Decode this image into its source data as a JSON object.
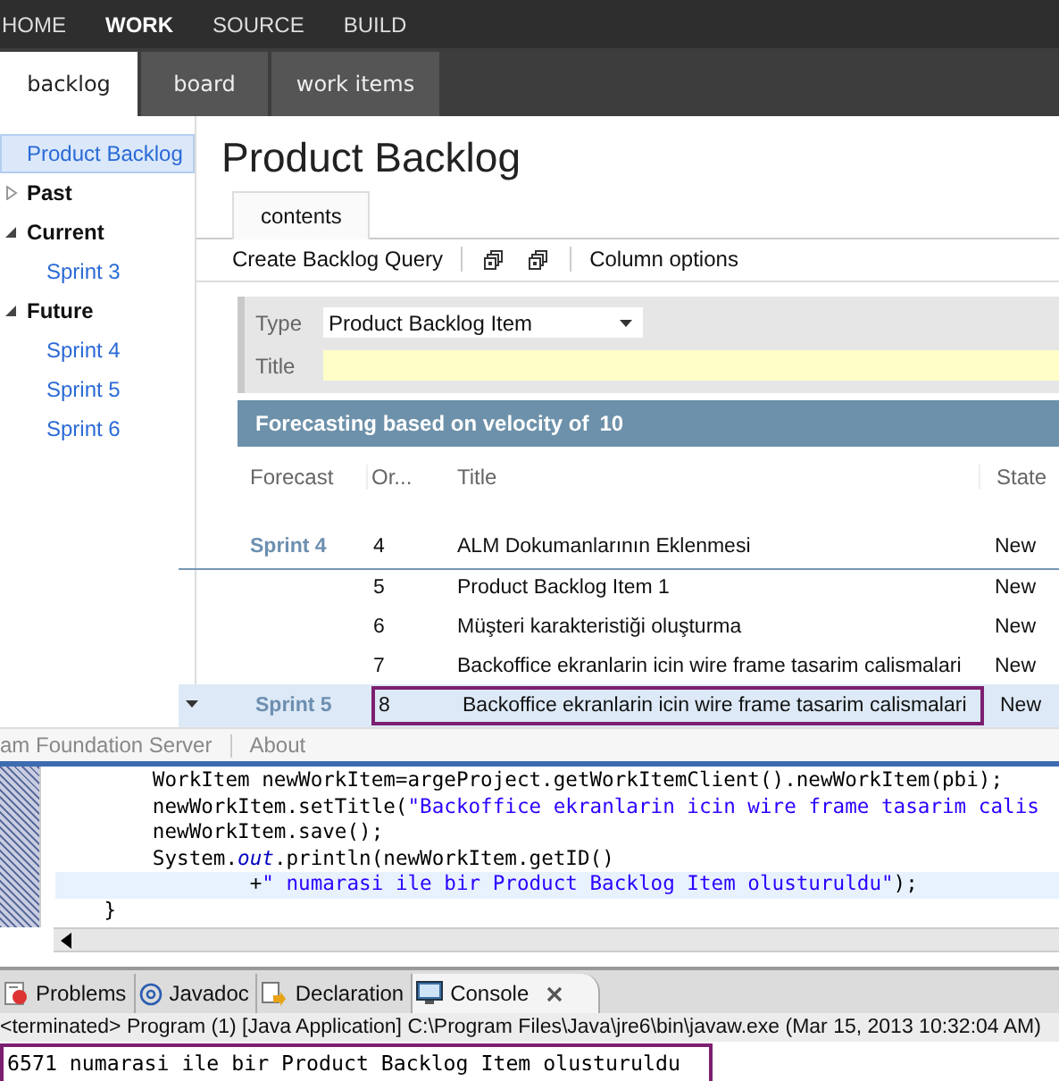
{
  "top_nav": [
    {
      "label": "HOME",
      "selected": false
    },
    {
      "label": "WORK",
      "selected": true
    },
    {
      "label": "SOURCE",
      "selected": false
    },
    {
      "label": "BUILD",
      "selected": false
    }
  ],
  "sub_tabs": [
    {
      "label": "backlog",
      "selected": true
    },
    {
      "label": "board",
      "selected": false
    },
    {
      "label": "work items",
      "selected": false
    }
  ],
  "sidebar": {
    "items": [
      {
        "label": "Product Backlog",
        "kind": "link",
        "selected": true
      },
      {
        "label": "Past",
        "kind": "group",
        "expanded": false
      },
      {
        "label": "Current",
        "kind": "group",
        "expanded": true,
        "children": [
          {
            "label": "Sprint 3",
            "kind": "link",
            "selected": false
          }
        ]
      },
      {
        "label": "Future",
        "kind": "group",
        "expanded": true,
        "children": [
          {
            "label": "Sprint 4",
            "kind": "link",
            "selected": false
          },
          {
            "label": "Sprint 5",
            "kind": "link",
            "selected": false
          },
          {
            "label": "Sprint 6",
            "kind": "link",
            "selected": false
          }
        ]
      }
    ]
  },
  "page_title": "Product Backlog",
  "content_tabs": [
    {
      "label": "contents",
      "selected": true
    }
  ],
  "toolbar": [
    {
      "kind": "text",
      "label": "Create Backlog Query"
    },
    {
      "kind": "separator"
    },
    {
      "kind": "expand"
    },
    {
      "kind": "collapse"
    },
    {
      "kind": "separator"
    },
    {
      "kind": "text",
      "label": "Column options"
    }
  ],
  "quick_add": {
    "type_label": "Type",
    "type_value": "Product Backlog Item",
    "title_label": "Title"
  },
  "forecast_banner": {
    "text": "Forecasting based on velocity of",
    "velocity": "10"
  },
  "table": {
    "columns": [
      "Forecast",
      "Or...",
      "Title",
      "State"
    ],
    "rows": [
      {
        "forecast": "Sprint 4",
        "order": "4",
        "title": "ALM Dokumanlarının Eklenmesi",
        "state": "New",
        "sprint_end": true,
        "selected": false,
        "boxed": false
      },
      {
        "order": "5",
        "title": "Product Backlog Item 1",
        "state": "New",
        "sprint_end": false,
        "selected": false,
        "boxed": false
      },
      {
        "order": "6",
        "title": "Müşteri karakteristiği oluşturma",
        "state": "New",
        "sprint_end": false,
        "selected": false,
        "boxed": false
      },
      {
        "order": "7",
        "title": "Backoffice ekranlarin icin wire frame tasarim calismalari",
        "state": "New",
        "sprint_end": false,
        "selected": false,
        "boxed": false
      },
      {
        "forecast": "Sprint 5",
        "order": "8",
        "title": "Backoffice ekranlarin icin wire frame tasarim calismalari",
        "state": "New",
        "sprint_end": false,
        "selected": true,
        "boxed": true
      }
    ]
  },
  "footer_links": [
    "am Foundation Server",
    "About"
  ],
  "editor": {
    "lines": [
      {
        "current": false,
        "segments": [
          {
            "kind": "plain",
            "text": "        WorkItem newWorkItem=argeProject.getWorkItemClient().newWorkItem(pbi);"
          }
        ]
      },
      {
        "current": false,
        "segments": [
          {
            "kind": "plain",
            "text": "        newWorkItem.setTitle("
          },
          {
            "kind": "string",
            "text": "\"Backoffice ekranlarin icin wire frame tasarim calis"
          }
        ]
      },
      {
        "current": false,
        "segments": [
          {
            "kind": "plain",
            "text": "        newWorkItem.save();"
          }
        ]
      },
      {
        "current": false,
        "segments": [
          {
            "kind": "plain",
            "text": "        System."
          },
          {
            "kind": "field",
            "text": "out"
          },
          {
            "kind": "plain",
            "text": ".println(newWorkItem.getID()"
          }
        ]
      },
      {
        "current": true,
        "segments": [
          {
            "kind": "plain",
            "text": "                +"
          },
          {
            "kind": "string",
            "text": "\" numarasi ile bir Product Backlog Item olusturuldu\""
          },
          {
            "kind": "plain",
            "text": ");"
          }
        ]
      },
      {
        "current": false,
        "segments": [
          {
            "kind": "plain",
            "text": "    }"
          }
        ]
      }
    ]
  },
  "bottom_tabs": [
    {
      "label": "Problems",
      "kind": "problems",
      "selected": false
    },
    {
      "label": "Javadoc",
      "kind": "javadoc",
      "selected": false
    },
    {
      "label": "Declaration",
      "kind": "declaration",
      "selected": false
    },
    {
      "label": "Console",
      "kind": "console",
      "selected": true,
      "closable": true
    }
  ],
  "console": {
    "header": "<terminated> Program (1) [Java Application] C:\\Program Files\\Java\\jre6\\bin\\javaw.exe (Mar 15, 2013 10:32:04 AM)",
    "output": "6571 numarasi ile bir Product Backlog Item olusturuldu",
    "boxed": true
  }
}
